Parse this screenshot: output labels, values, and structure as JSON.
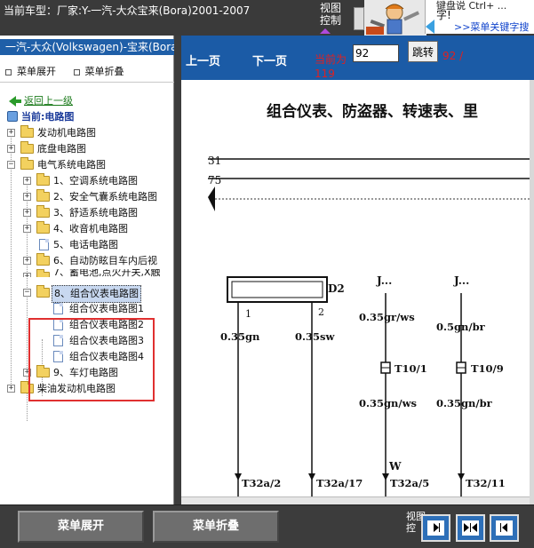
{
  "topbar": {
    "title": "当前车型：厂家:Y-一汽-大众宝来(Bora)2001-2007",
    "view_control_line1": "视图",
    "view_control_line2": "控制",
    "notice_line1": "键盘说 Ctrl+ ...",
    "notice_line2": "字!",
    "notice_link": ">>菜单关键字搜"
  },
  "left_panel": {
    "header": "一汽-大众(Volkswagen)-宝来(Bora)",
    "expand_label": "菜单展开",
    "collapse_label": "菜单折叠",
    "back_label": "返回上一级",
    "current_label": "当前:电路图"
  },
  "tree": {
    "top_items": [
      {
        "label": "发动机电路图"
      },
      {
        "label": "底盘电路图"
      },
      {
        "label": "电气系统电路图"
      }
    ],
    "electrical_children": [
      {
        "label": "1、空调系统电路图"
      },
      {
        "label": "2、安全气囊系统电路图"
      },
      {
        "label": "3、舒适系统电路图"
      },
      {
        "label": "4、收音机电路图"
      },
      {
        "label": "5、电话电路图"
      },
      {
        "label": "6、自动防眩目车内后视"
      },
      {
        "label": "7、蓄电池,点火开关,X触"
      },
      {
        "label": "8、组合仪表电路图"
      }
    ],
    "cluster_children": [
      {
        "label": "组合仪表电路图1"
      },
      {
        "label": "组合仪表电路图2"
      },
      {
        "label": "组合仪表电路图3"
      },
      {
        "label": "组合仪表电路图4"
      }
    ],
    "after_items": [
      {
        "label": "9、车灯电路图"
      }
    ],
    "diesel_item": {
      "label": "柴油发动机电路图"
    }
  },
  "navbar": {
    "prev_label": "上一页",
    "next_label": "下一页",
    "current_page_label": "当前为",
    "page_value": "92",
    "jump_label": "跳转",
    "page_total_part1": "92 /",
    "page_total_part2": "119"
  },
  "diagram": {
    "title": "组合仪表、防盗器、转速表、里",
    "wire_31": "31",
    "wire_75": "75",
    "component_d2": "D2",
    "pin_1": "1",
    "pin_2": "2",
    "j_labels": [
      "J...",
      "J...",
      "("
    ],
    "wire_labels_top": [
      "0.35gn",
      "0.35sw",
      "0.35gr/ws",
      "0.5gn/br"
    ],
    "connectors": [
      "T10/1",
      "T10/9"
    ],
    "wire_labels_mid": [
      "0.35gn/ws",
      "0.35gn/br"
    ],
    "w_label": "W",
    "bottom_terminals": [
      "T32a/2",
      "T32a/17",
      "T32a/5",
      "T32/11"
    ]
  },
  "bottombar": {
    "expand_label": "菜单展开",
    "collapse_label": "菜单折叠",
    "view_label1": "视图",
    "view_label2": "控"
  },
  "colors": {
    "nav_blue": "#1b5ba6",
    "highlight_red": "#e03030",
    "page_red": "#e02020"
  }
}
